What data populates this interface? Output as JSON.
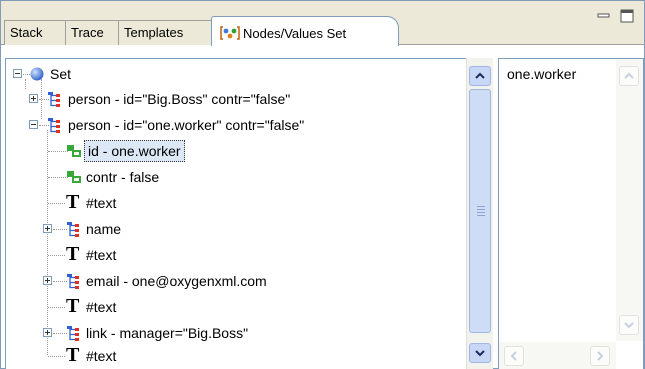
{
  "tabs": [
    {
      "label": "Stack"
    },
    {
      "label": "Trace"
    },
    {
      "label": "Templates"
    },
    {
      "label": "Nodes/Values Set",
      "active": true,
      "icon": "node-set-icon"
    }
  ],
  "tree": {
    "root": {
      "label": "Set",
      "icon": "blue-ball-icon",
      "expanded": true
    },
    "rows": [
      {
        "label": "person - id=\"Big.Boss\" contr=\"false\"",
        "icon": "element-icon",
        "expander": "plus"
      },
      {
        "label": "person - id=\"one.worker\" contr=\"false\"",
        "icon": "element-icon",
        "expander": "minus"
      },
      {
        "label": "id - one.worker",
        "icon": "attribute-icon",
        "selected": true
      },
      {
        "label": "contr - false",
        "icon": "attribute-icon"
      },
      {
        "label": "#text",
        "icon": "text-node-icon"
      },
      {
        "label": "name",
        "icon": "element-icon",
        "expander": "plus"
      },
      {
        "label": "#text",
        "icon": "text-node-icon"
      },
      {
        "label": "email - one@oxygenxml.com",
        "icon": "element-icon",
        "expander": "plus"
      },
      {
        "label": "#text",
        "icon": "text-node-icon"
      },
      {
        "label": "link - manager=\"Big.Boss\"",
        "icon": "element-icon",
        "expander": "plus"
      },
      {
        "label": "#text",
        "icon": "text-node-icon"
      }
    ]
  },
  "values_pane": {
    "value": "one.worker"
  },
  "colors": {
    "border": "#7f9db9",
    "selection": "#dde8f6",
    "tab_bg": "#ece9d8",
    "scroll_thumb": "#cfdcf6"
  }
}
